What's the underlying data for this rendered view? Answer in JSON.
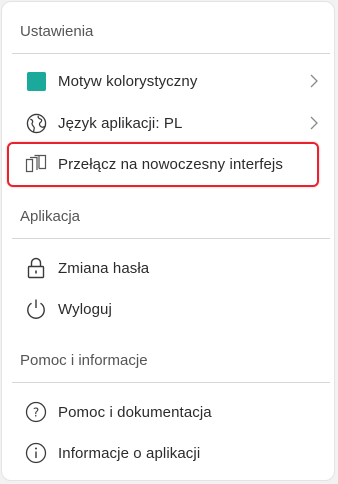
{
  "settings": {
    "header": "Ustawienia",
    "items": [
      {
        "label": "Motyw kolorystyczny",
        "swatch_color": "#1aa99b"
      },
      {
        "label": "Język aplikacji: PL"
      },
      {
        "label": "Przełącz na nowoczesny interfejs",
        "highlight_color": "#e8232d"
      }
    ]
  },
  "application": {
    "header": "Aplikacja",
    "items": [
      {
        "label": "Zmiana hasła"
      },
      {
        "label": "Wyloguj"
      }
    ]
  },
  "help": {
    "header": "Pomoc i informacje",
    "items": [
      {
        "label": "Pomoc i dokumentacja"
      },
      {
        "label": "Informacje o aplikacji"
      }
    ]
  },
  "icons": {
    "theme": "color-swatch-icon",
    "language": "globe-icon",
    "switch_ui": "switch-interface-icon",
    "password": "lock-icon",
    "logout": "power-icon",
    "help": "question-circle-icon",
    "info": "info-circle-icon",
    "chevron": "chevron-right-icon"
  }
}
